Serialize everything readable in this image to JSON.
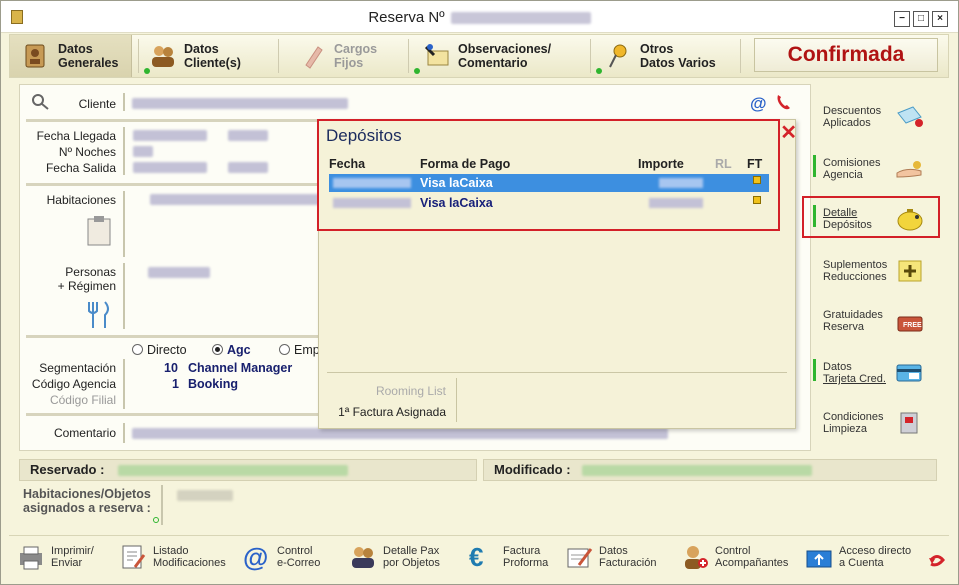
{
  "window": {
    "title": "Reserva Nº"
  },
  "toolbar": {
    "tabs": [
      {
        "line1": "Datos",
        "line2": "Generales"
      },
      {
        "line1": "Datos",
        "line2": "Cliente(s)"
      },
      {
        "line1": "Cargos",
        "line2": "Fijos"
      },
      {
        "line1": "Observaciones/",
        "line2": "Comentario"
      },
      {
        "line1": "Otros",
        "line2": "Datos Varios"
      }
    ],
    "status": "Confirmada"
  },
  "form": {
    "cliente_label": "Cliente",
    "fecha_llegada_label": "Fecha Llegada",
    "noches_label": "Nº Noches",
    "fecha_salida_label": "Fecha Salida",
    "habitaciones_label": "Habitaciones",
    "personas_label": "Personas",
    "regimen_label": "+ Régimen",
    "radio_directo": "Directo",
    "radio_agc": "Agc",
    "radio_emp": "Emp",
    "segmentacion_label": "Segmentación",
    "segmentacion_code": "10",
    "segmentacion_value": "Channel Manager",
    "codigo_agencia_label": "Código Agencia",
    "codigo_agencia_code": "1",
    "codigo_agencia_value": "Booking",
    "codigo_filial_label": "Código Filial",
    "comentario_label": "Comentario"
  },
  "depositos": {
    "title": "Depósitos",
    "columns": [
      "Fecha",
      "Forma de Pago",
      "Importe",
      "RL",
      "FT"
    ],
    "rows": [
      {
        "forma_pago": "Visa laCaixa"
      },
      {
        "forma_pago": "Visa laCaixa"
      }
    ],
    "rooming_list": "Rooming List",
    "factura": "1ª Factura Asignada"
  },
  "sidebar": {
    "items": [
      {
        "line1": "Descuentos",
        "line2": "Aplicados"
      },
      {
        "line1": "Comisiones",
        "line2": "Agencia"
      },
      {
        "line1": "Detalle",
        "line2": "Depósitos"
      },
      {
        "line1": "Suplementos",
        "line2": "Reducciones"
      },
      {
        "line1": "Gratuidades",
        "line2": "Reserva"
      },
      {
        "line1": "Datos",
        "line2": "Tarjeta Cred."
      },
      {
        "line1": "Condiciones",
        "line2": "Limpieza"
      }
    ]
  },
  "status": {
    "reservado_label": "Reservado :",
    "modificado_label": "Modificado :",
    "asignados_line1": "Habitaciones/Objetos",
    "asignados_line2": "asignados a reserva :"
  },
  "footer": {
    "buttons": [
      {
        "line1": "Imprimir/",
        "line2": "Enviar"
      },
      {
        "line1": "Listado",
        "line2": "Modificaciones"
      },
      {
        "line1": "Control",
        "line2": "e-Correo"
      },
      {
        "line1": "Detalle Pax",
        "line2": "por Objetos"
      },
      {
        "line1": "Factura",
        "line2": "Proforma"
      },
      {
        "line1": "Datos",
        "line2": "Facturación"
      },
      {
        "line1": "Control",
        "line2": "Acompañantes"
      },
      {
        "line1": "Acceso directo",
        "line2": "a Cuenta"
      }
    ]
  },
  "colors": {
    "status_red": "#b01313",
    "highlight_red": "#d32028",
    "selection_blue": "#3d8fe0",
    "navy": "#18206e",
    "green_indicator": "#2fb52f"
  }
}
